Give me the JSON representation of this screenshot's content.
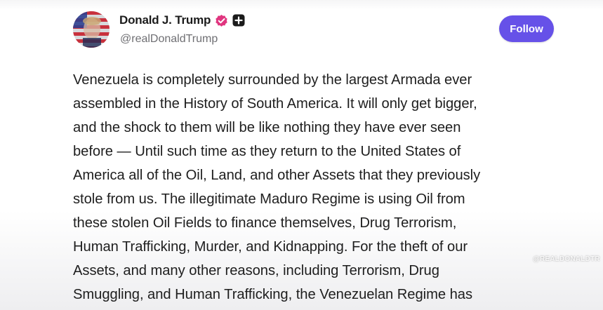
{
  "post": {
    "author_name": "Donald J. Trump",
    "handle": "@realDonaldTrump",
    "follow_label": "Follow",
    "body_lines": [
      "Venezuela is completely surrounded by the largest Armada ever",
      "assembled in the History of South America. It will only get bigger,",
      "and the shock to them will be like nothing they have ever seen",
      "before — Until such time as they return to the United States of",
      "America all of the Oil, Land, and other Assets that they previously",
      "stole from us. The illegitimate Maduro Regime is using Oil from",
      "these stolen Oil Fields to finance themselves, Drug Terrorism,",
      "Human Trafficking, Murder, and Kidnapping. For the theft of our",
      "Assets, and many other reasons, including Terrorism, Drug",
      "Smuggling, and Human Trafficking, the Venezuelan Regime has"
    ]
  },
  "icons": {
    "verified": "verified-badge-icon",
    "plus": "plus-badge-icon",
    "avatar": "profile-avatar"
  },
  "colors": {
    "follow_button": "#6651e8",
    "verified_badge": "#e0357f",
    "plus_badge": "#1b1b1b",
    "handle_text": "#6f6f73"
  },
  "watermark": "@REALDONALDTR"
}
